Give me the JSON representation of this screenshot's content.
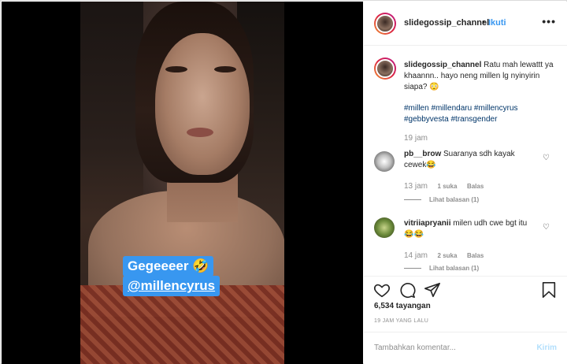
{
  "video": {
    "sticker_line1": "Gegeeeer 🤣",
    "sticker_line2": "@millencyrus"
  },
  "header": {
    "username": "slidegossip_channel",
    "separator": "•",
    "follow_label": "Ikuti",
    "more_label": "•••"
  },
  "caption": {
    "username": "slidegossip_channel",
    "text": "Ratu mah lewattt ya khaannn.. hayo neng millen lg nyinyirin siapa? 😳",
    "hashtags": "#millen #millendaru #millencyrus #gebbyvesta #transgender",
    "time": "19 jam"
  },
  "comments": [
    {
      "username": "pb__brow",
      "text": "Suaranya sdh kayak cewek😂",
      "time": "13 jam",
      "likes": "1 suka",
      "reply_label": "Balas",
      "view_replies": "Lihat balasan (1)"
    },
    {
      "username": "vitriiapryanii",
      "text": "milen udh cwe bgt itu 😂😂",
      "time": "14 jam",
      "likes": "2 suka",
      "reply_label": "Balas",
      "view_replies": "Lihat balasan (1)"
    }
  ],
  "stats": {
    "views": "6,534 tayangan",
    "posted_ago": "19 JAM YANG LALU"
  },
  "add_comment": {
    "placeholder": "Tambahkan komentar...",
    "send_label": "Kirim"
  },
  "colors": {
    "accent": "#3897f0",
    "hashtag": "#003569",
    "muted": "#8e8e8e",
    "send_disabled": "#b2dffc"
  }
}
